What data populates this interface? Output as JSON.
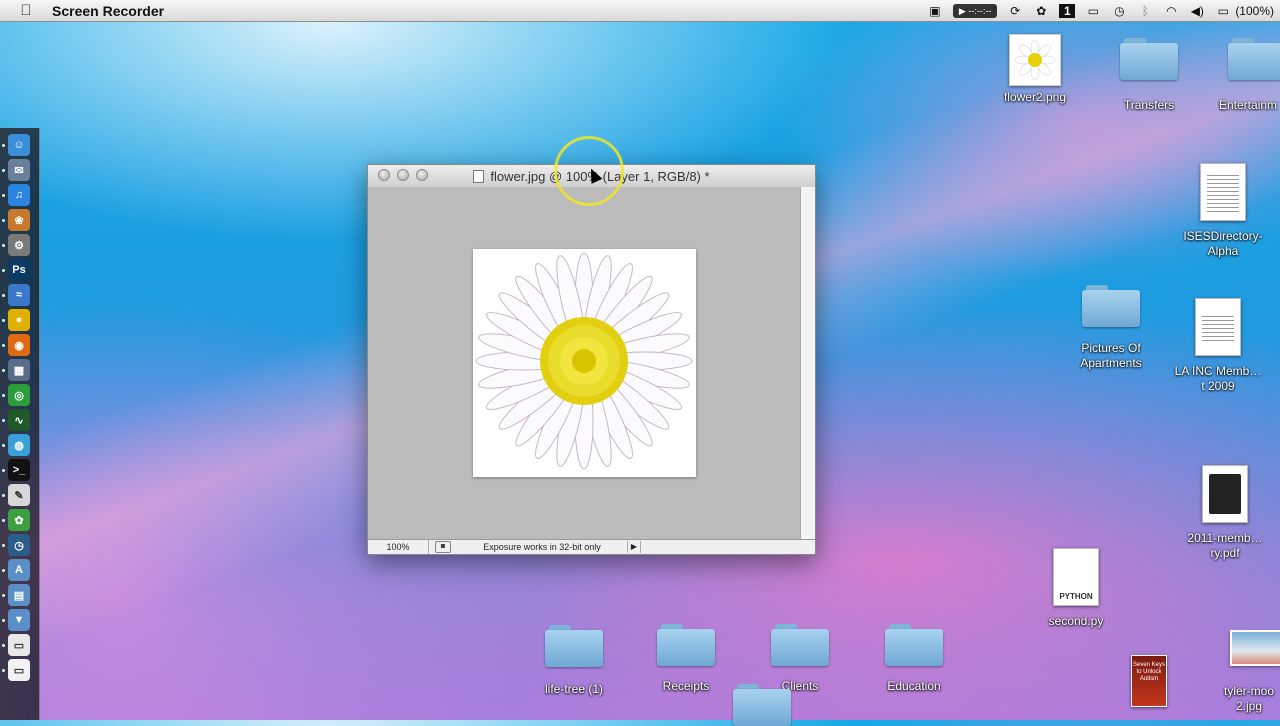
{
  "menubar": {
    "app_name": "Screen Recorder",
    "apple_icon": "apple-logo-icon",
    "recorder_time": "▶ --:--:--",
    "battery_percent": "(100%)",
    "status_icons": [
      "display-icon",
      "recorder-icon",
      "sync-icon",
      "settings-icon",
      "one-badge-icon",
      "screen-icon",
      "time-machine-icon",
      "bluetooth-icon",
      "wifi-icon",
      "volume-icon",
      "battery-icon"
    ]
  },
  "dock": {
    "items": [
      {
        "name": "finder",
        "glyph": "☺",
        "color": "#3a8fd8"
      },
      {
        "name": "mail",
        "glyph": "✉",
        "color": "#6a7f9c"
      },
      {
        "name": "itunes",
        "glyph": "♫",
        "color": "#2a84e0"
      },
      {
        "name": "iphoto",
        "glyph": "❀",
        "color": "#c77a2c"
      },
      {
        "name": "system-preferences",
        "glyph": "⚙",
        "color": "#7a7a7a"
      },
      {
        "name": "photoshop",
        "glyph": "Ps",
        "color": "#0b3a63"
      },
      {
        "name": "wave-app",
        "glyph": "≈",
        "color": "#3a78c8"
      },
      {
        "name": "cyberduck",
        "glyph": "●",
        "color": "#e0b000"
      },
      {
        "name": "firefox",
        "glyph": "◉",
        "color": "#e06a12"
      },
      {
        "name": "grid-app",
        "glyph": "▦",
        "color": "#5a6d88"
      },
      {
        "name": "chrome",
        "glyph": "◎",
        "color": "#2a9e3a"
      },
      {
        "name": "activity-monitor",
        "glyph": "∿",
        "color": "#1f5a2a"
      },
      {
        "name": "globe-app",
        "glyph": "◍",
        "color": "#3aa0d8"
      },
      {
        "name": "terminal",
        "glyph": ">_",
        "color": "#111111"
      },
      {
        "name": "preview",
        "glyph": "✎",
        "color": "#d8d8d8"
      },
      {
        "name": "frog-app",
        "glyph": "✿",
        "color": "#3da040"
      },
      {
        "name": "time-app",
        "glyph": "◷",
        "color": "#2b5c8a"
      },
      {
        "name": "applications-folder",
        "glyph": "A",
        "color": "#5a8fc8"
      },
      {
        "name": "documents-folder",
        "glyph": "▤",
        "color": "#5a8fc8"
      },
      {
        "name": "downloads-folder",
        "glyph": "▼",
        "color": "#5a8fc8"
      },
      {
        "name": "calendar",
        "glyph": "▭",
        "color": "#e8e8e8"
      },
      {
        "name": "notes",
        "glyph": "▭",
        "color": "#f2f2f2"
      }
    ]
  },
  "desktop_icons": [
    {
      "label": "flower2.png",
      "kind": "image"
    },
    {
      "label": "Transfers",
      "kind": "folder"
    },
    {
      "label": "Entertainm",
      "kind": "folder"
    },
    {
      "label": "ISESDirectory-Alpha",
      "kind": "doc"
    },
    {
      "label": "Pictures Of Apartments",
      "kind": "folder"
    },
    {
      "label": "LA INC Memb…t 2009",
      "kind": "doc"
    },
    {
      "label": "2011-memb…ry.pdf",
      "kind": "pdf"
    },
    {
      "label": "second.py",
      "kind": "python",
      "tag": "PYTHON"
    },
    {
      "label": "life-tree (1)",
      "kind": "folder"
    },
    {
      "label": "Receipts",
      "kind": "folder"
    },
    {
      "label": "Clients",
      "kind": "folder"
    },
    {
      "label": "Education",
      "kind": "folder"
    },
    {
      "label": "tyler-moo 2.jpg",
      "kind": "image"
    },
    {
      "label": "",
      "kind": "book-cover",
      "cover_text": "Seven Keys to Unlock Autism"
    }
  ],
  "photoshop_window": {
    "title": "flower.jpg @ 100% (Layer 1, RGB/8) *",
    "zoom": "100%",
    "status_message": "Exposure works in 32-bit only",
    "image_subject": "white daisy flower with yellow center"
  }
}
